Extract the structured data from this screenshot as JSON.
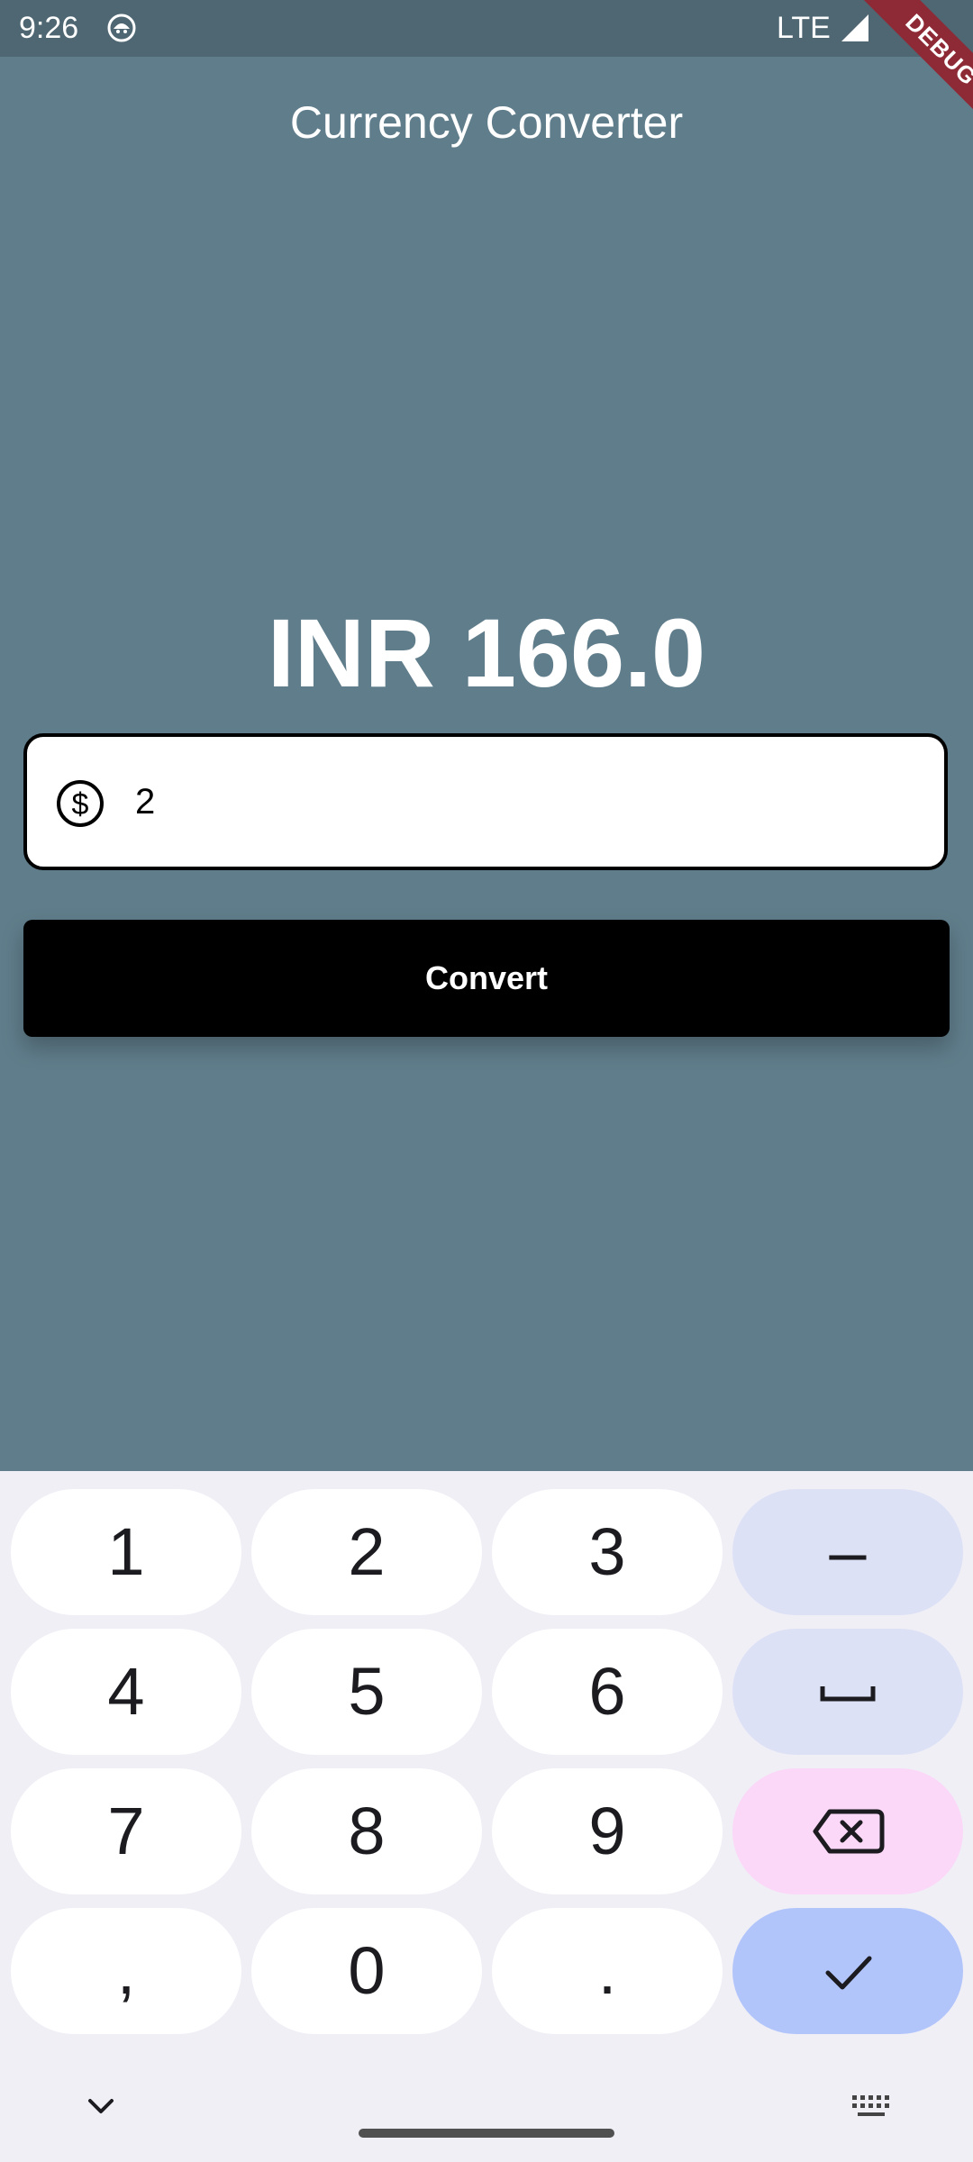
{
  "status_bar": {
    "time": "9:26",
    "network": "LTE",
    "app_icon": "android-debug-icon",
    "signal_icon": "signal-icon"
  },
  "debug_banner": "DEBUG",
  "app_bar": {
    "title": "Currency Converter"
  },
  "result": {
    "text": "INR 166.0"
  },
  "amount_input": {
    "prefix_icon": "dollar-circle-icon",
    "value": "2"
  },
  "convert_button": {
    "label": "Convert"
  },
  "keyboard": {
    "keys": [
      "1",
      "2",
      "3",
      "–",
      "4",
      "5",
      "6",
      "7",
      "8",
      "9",
      ",",
      "0",
      "."
    ],
    "space_icon": "space-icon",
    "delete_icon": "backspace-icon",
    "enter_icon": "check-icon",
    "hide_icon": "chevron-down-icon",
    "switch_icon": "keyboard-icon"
  },
  "colors": {
    "background": "#607d8b",
    "status_bar": "#4f6773",
    "button": "#000000",
    "debug_ribbon": "#8e2a36",
    "keyboard_bg": "#f0eff6",
    "key_func": "#dde1f6",
    "key_delete": "#fbd7f8",
    "key_enter": "#b2c5fb"
  }
}
